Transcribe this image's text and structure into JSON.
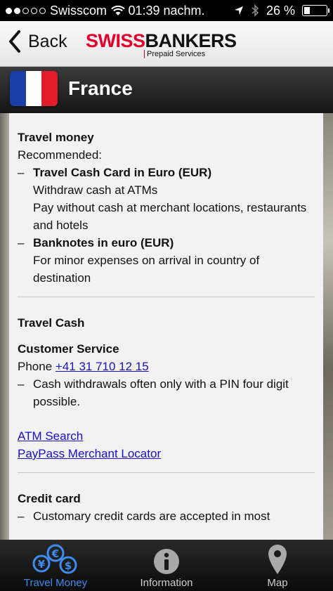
{
  "status_bar": {
    "carrier": "Swisscom",
    "time": "01:39 nachm.",
    "battery_text": "26 %",
    "battery_level": 0.26
  },
  "nav": {
    "back_label": "Back",
    "brand_swiss": "SWISS",
    "brand_bankers": "BANKERS",
    "brand_sub": "Prepaid Services"
  },
  "title_bar": {
    "country": "France",
    "flag_colors": [
      "#1a3ea8",
      "#ffffff",
      "#e21c2a"
    ]
  },
  "content": {
    "travel_money": {
      "heading": "Travel money",
      "recommended": "Recommended:",
      "dash": "–",
      "item1_title": "Travel Cash Card in Euro (EUR)",
      "item1_line1": "Withdraw cash at ATMs",
      "item1_line2": "Pay without cash at merchant locations, restaurants and hotels",
      "item2_title": "Banknotes in euro (EUR)",
      "item2_line1": "For minor expenses on arrival in country of destination"
    },
    "travel_cash": {
      "heading": "Travel Cash",
      "customer_service": "Customer Service",
      "phone_label": "Phone ",
      "phone_number": "+41 31 710 12 15",
      "note": "Cash withdrawals often only with a PIN four digit possible.",
      "atm_search": "ATM Search",
      "paypass": "PayPass Merchant Locator"
    },
    "credit_card": {
      "heading": "Credit card",
      "note": "Customary credit cards are accepted in most"
    }
  },
  "tabs": [
    {
      "label": "Travel Money",
      "icon": "currency-icon",
      "active": true
    },
    {
      "label": "Information",
      "icon": "info-icon",
      "active": false
    },
    {
      "label": "Map",
      "icon": "map-pin-icon",
      "active": false
    }
  ],
  "colors": {
    "accent_blue": "#3f8bf0",
    "brand_red": "#e4002b",
    "link": "#1a0dcc"
  }
}
